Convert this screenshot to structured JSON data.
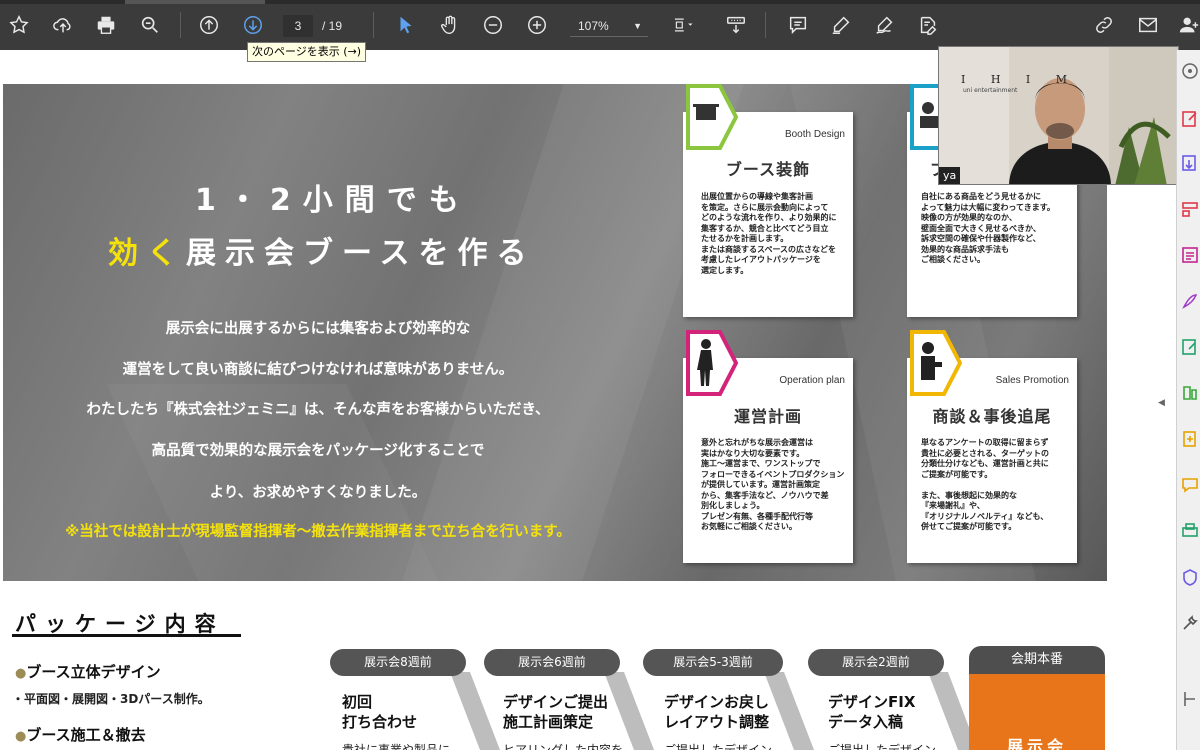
{
  "toolbar": {
    "page_current": "3",
    "page_total": "/ 19",
    "zoom": "107%",
    "tooltip": "次のページを表示 (→)",
    "icons": [
      "star-icon",
      "upload-icon",
      "print-icon",
      "zoom-search-icon",
      "prev-page-icon",
      "next-page-icon",
      "select-cursor-icon",
      "hand-icon",
      "zoom-out-icon",
      "zoom-in-icon",
      "fit-page-icon",
      "scroll-mode-icon",
      "comment-icon",
      "highlight-pen-icon",
      "sign-icon",
      "edit-text-icon",
      "share-link-icon",
      "email-icon",
      "add-user-icon"
    ]
  },
  "webcam": {
    "sign_text": "I H I M",
    "sign_sub": "uni entertainment",
    "name_tag": "ya"
  },
  "hero": {
    "title_line1": "1・2小間でも",
    "title_highlight": "効く",
    "title_line2_rest": "展示会ブースを作る",
    "lines": [
      "展示会に出展するからには集客および効率的な",
      "運営をして良い商談に結びつけなければ意味がありません。",
      "わたしたち『株式会社ジェミニ』は、そんな声をお客様からいただき、",
      "高品質で効果的な展示会をパッケージ化することで",
      "より、お求めやすくなりました。"
    ],
    "notice": "※当社では設計士が現場監督指揮者～撤去作業指揮者まで立ち合を行います。"
  },
  "cards": [
    {
      "en": "Booth Design",
      "jp": "ブース装飾",
      "body": "出展位置からの導線や集客計画\nを策定。さらに展示会動向によって\nどのような流れを作り、より効果的に\n集客するか、競合と比べてどう目立\nたせるかを計画します。\nまたは商談するスペースの広さなどを\n考慮したレイアウトパッケージを\n選定します。"
    },
    {
      "en": "",
      "jp": "ブ",
      "body": "自社にある商品をどう見せるかに\nよって魅力は大幅に変わってきます。\n映像の方が効果的なのか、\n壁面全面で大きく見せるべきか、\n訴求空間の確保や什器製作など、\n効果的な商品訴求手法も\nご相談ください。"
    },
    {
      "en": "Operation plan",
      "jp": "運営計画",
      "body": "意外と忘れがちな展示会運営は\n実はかなり大切な要素です。\n施工～運営まで、ワンストップで\nフォローできるイベントプロダクション\nが提供しています。運営計画策定\nから、集客手法など、ノウハウで差\n別化しましょう。\nプレゼン有無、各種手配代行等\nお気軽にご相談ください。"
    },
    {
      "en": "Sales  Promotion",
      "jp": "商談＆事後追尾",
      "body": "単なるアンケートの取得に留まらず\n貴社に必要とされる、ターゲットの\n分類仕分けなども、運営計画と共に\nご提案が可能です。\n\nまた、事後想起に効果的な\n『来場謝礼』や、\n『オリジナルノベルティ』なども、\n併せてご提案が可能です。"
    }
  ],
  "package": {
    "title": "パッケージ内容",
    "items": [
      "ブース立体デザイン",
      "ブース施工＆撤去"
    ],
    "sub": "・平面図・展開図・3Dパース制作。",
    "steps": [
      {
        "label": "展示会8週前",
        "title": "初回\n打ち合わせ",
        "body": "貴社に事業や製品に"
      },
      {
        "label": "展示会6週前",
        "title": "デザインご提出\n施工計画策定",
        "body": "ヒアリングした内容を"
      },
      {
        "label": "展示会5-3週前",
        "title": "デザインお戻し\nレイアウト調整",
        "body": "ご提出したデザイン"
      },
      {
        "label": "展示会2週前",
        "title": "デザインFIX\nデータ入稿",
        "body": "ご提出したデザイン"
      }
    ],
    "final_label": "会期本番",
    "final_text": "展示会"
  },
  "colors": {
    "toolbar_bg": "#3b3b3b",
    "accent_blue": "#5ea2ef",
    "highlight_yellow": "#f5e20d",
    "card_green": "#8cc63f",
    "card_cyan": "#1ba1c7",
    "card_magenta": "#d4237a",
    "card_yellow": "#f2b705",
    "final_orange": "#e8751a"
  }
}
